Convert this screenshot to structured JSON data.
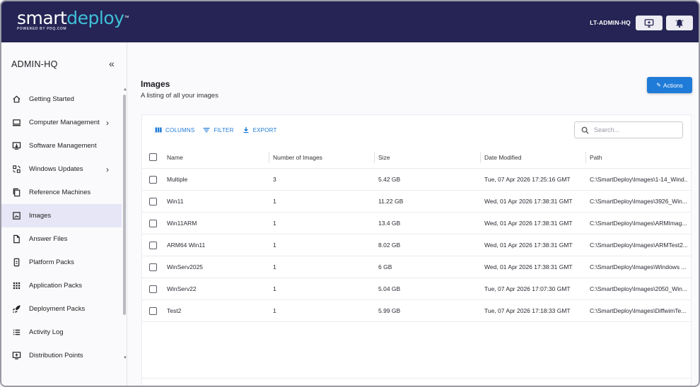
{
  "header": {
    "logo_smart": "smart",
    "logo_deploy": "deploy",
    "logo_sub": "POWERED BY PDQ.COM",
    "hostname": "LT-ADMIN-HQ",
    "icons": [
      "monitor-add-icon",
      "bell-icon"
    ]
  },
  "sidebar": {
    "machine": "ADMIN-HQ",
    "collapse_label": "«",
    "items": [
      {
        "label": "Getting Started",
        "icon": "home-icon"
      },
      {
        "label": "Computer Management",
        "icon": "laptop-icon",
        "chevron": "›"
      },
      {
        "label": "Software Management",
        "icon": "software-icon"
      },
      {
        "label": "Windows Updates",
        "icon": "updates-icon",
        "chevron": "›"
      },
      {
        "label": "Reference Machines",
        "icon": "copy-icon"
      },
      {
        "label": "Images",
        "icon": "image-icon",
        "active": true
      },
      {
        "label": "Answer Files",
        "icon": "file-icon"
      },
      {
        "label": "Platform Packs",
        "icon": "platform-icon"
      },
      {
        "label": "Application Packs",
        "icon": "apps-grid-icon"
      },
      {
        "label": "Deployment Packs",
        "icon": "rocket-icon"
      },
      {
        "label": "Activity Log",
        "icon": "list-icon"
      },
      {
        "label": "Distribution Points",
        "icon": "distribution-icon"
      }
    ]
  },
  "main": {
    "title": "Images",
    "subtitle": "A listing of all your images",
    "actions_label": "Actions",
    "toolbar": {
      "columns": "COLUMNS",
      "filter": "FILTER",
      "export": "EXPORT"
    },
    "search_placeholder": "Search...",
    "table": {
      "headers": {
        "name": "Name",
        "num": "Number of Images",
        "size": "Size",
        "date": "Date Modified",
        "path": "Path"
      },
      "rows": [
        {
          "name": "Multiple",
          "num": "3",
          "size": "5.42 GB",
          "date": "Tue, 07 Apr 2026 17:25:16 GMT",
          "path": "C:\\SmartDeploy\\Images\\1-14_Wind..."
        },
        {
          "name": "Win11",
          "num": "1",
          "size": "11.22 GB",
          "date": "Wed, 01 Apr 2026 17:38:31 GMT",
          "path": "C:\\SmartDeploy\\Images\\3926_Win..."
        },
        {
          "name": "Win11ARM",
          "num": "1",
          "size": "13.4 GB",
          "date": "Wed, 01 Apr 2026 17:38:31 GMT",
          "path": "C:\\SmartDeploy\\Images\\ARMImag..."
        },
        {
          "name": "ARM64 Win11",
          "num": "1",
          "size": "8.02 GB",
          "date": "Wed, 01 Apr 2026 17:38:31 GMT",
          "path": "C:\\SmartDeploy\\Images\\ARMTest2..."
        },
        {
          "name": "WinServ2025",
          "num": "1",
          "size": "6 GB",
          "date": "Wed, 01 Apr 2026 17:38:31 GMT",
          "path": "C:\\SmartDeploy\\Images\\Windows ..."
        },
        {
          "name": "WinServ22",
          "num": "1",
          "size": "5.04 GB",
          "date": "Tue, 07 Apr 2026 17:07:30 GMT",
          "path": "C:\\SmartDeploy\\Images\\2050_Win..."
        },
        {
          "name": "Test2",
          "num": "1",
          "size": "5.99 GB",
          "date": "Tue, 07 Apr 2026 17:18:33 GMT",
          "path": "C:\\SmartDeploy\\Images\\DiffwimTe..."
        }
      ]
    }
  },
  "colors": {
    "header_bg": "#252454",
    "accent": "#1f7bd8",
    "active_nav": "#e6e6f6",
    "logo_teal": "#3fc0d8"
  }
}
